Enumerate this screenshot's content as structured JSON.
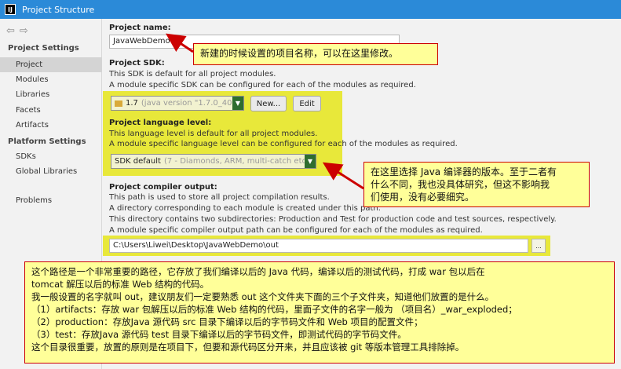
{
  "window": {
    "title": "Project Structure",
    "icon": "intellij-icon"
  },
  "sidebar": {
    "nav_back": "⇦",
    "nav_forward": "⇨",
    "project_settings_header": "Project Settings",
    "project_settings_items": [
      "Project",
      "Modules",
      "Libraries",
      "Facets",
      "Artifacts"
    ],
    "selected_item": "Project",
    "platform_settings_header": "Platform Settings",
    "platform_settings_items": [
      "SDKs",
      "Global Libraries"
    ],
    "problems": "Problems"
  },
  "project": {
    "name_label": "Project name:",
    "name_value": "JavaWebDemo",
    "sdk_label": "Project SDK:",
    "sdk_desc1": "This SDK is default for all project modules.",
    "sdk_desc2": "A module specific SDK can be configured for each of the modules as required.",
    "sdk_value": "1.7",
    "sdk_detail": "(java version \"1.7.0_40\")",
    "new_button": "New...",
    "edit_button": "Edit",
    "lang_label": "Project language level:",
    "lang_desc1": "This language level is default for all project modules.",
    "lang_desc2": "A module specific language level can be configured for each of the modules as required.",
    "lang_value": "SDK default",
    "lang_detail": "(7 - Diamonds, ARM, multi-catch etc.)",
    "output_label": "Project compiler output:",
    "output_desc1": "This path is used to store all project compilation results.",
    "output_desc2": "A directory corresponding to each module is created under this path.",
    "output_desc3": "This directory contains two subdirectories: Production and Test for production code and test sources, respectively.",
    "output_desc4": "A module specific compiler output path can be configured for each of the modules as required.",
    "output_path": "C:\\Users\\Liwei\\Desktop\\JavaWebDemo\\out",
    "browse_button": "..."
  },
  "annotations": {
    "name_note": "新建的时候设置的项目名称，可以在这里修改。",
    "lang_note": [
      "在这里选择 Java 编译器的版本。至于二者有",
      "什么不同，我也没具体研究，但这不影响我",
      "们使用，没有必要细究。"
    ],
    "output_note": [
      "这个路径是一个非常重要的路径，它存放了我们编译以后的 Java 代码，编译以后的测试代码，打成 war 包以后在",
      "tomcat 解压以后的标准 Web 结构的代码。",
      "我一般设置的名字就叫 out，建议朋友们一定要熟悉 out 这个文件夹下面的三个子文件夹，知道他们放置的是什么。",
      "（1）artifacts：存放 war 包解压以后的标准 Web 结构的代码，里面子文件的名字一般为 （项目名）_war_exploded；",
      "（2）production：存放Java 源代码 src 目录下编译以后的字节码文件和 Web 项目的配置文件；",
      "（3）test：存放Java 源代码 test 目录下编译以后的字节码文件，即测试代码的字节码文件。",
      "这个目录很重要，放置的原则是在项目下，但要和源代码区分开来，并且应该被 git 等版本管理工具排除掉。"
    ]
  },
  "colors": {
    "titlebar": "#2b8ad8",
    "highlight": "#e8e83a",
    "note_bg": "#ffff99",
    "note_border": "#cc0000",
    "arrow": "#cc0000",
    "dropdown": "#2f6d2f"
  }
}
